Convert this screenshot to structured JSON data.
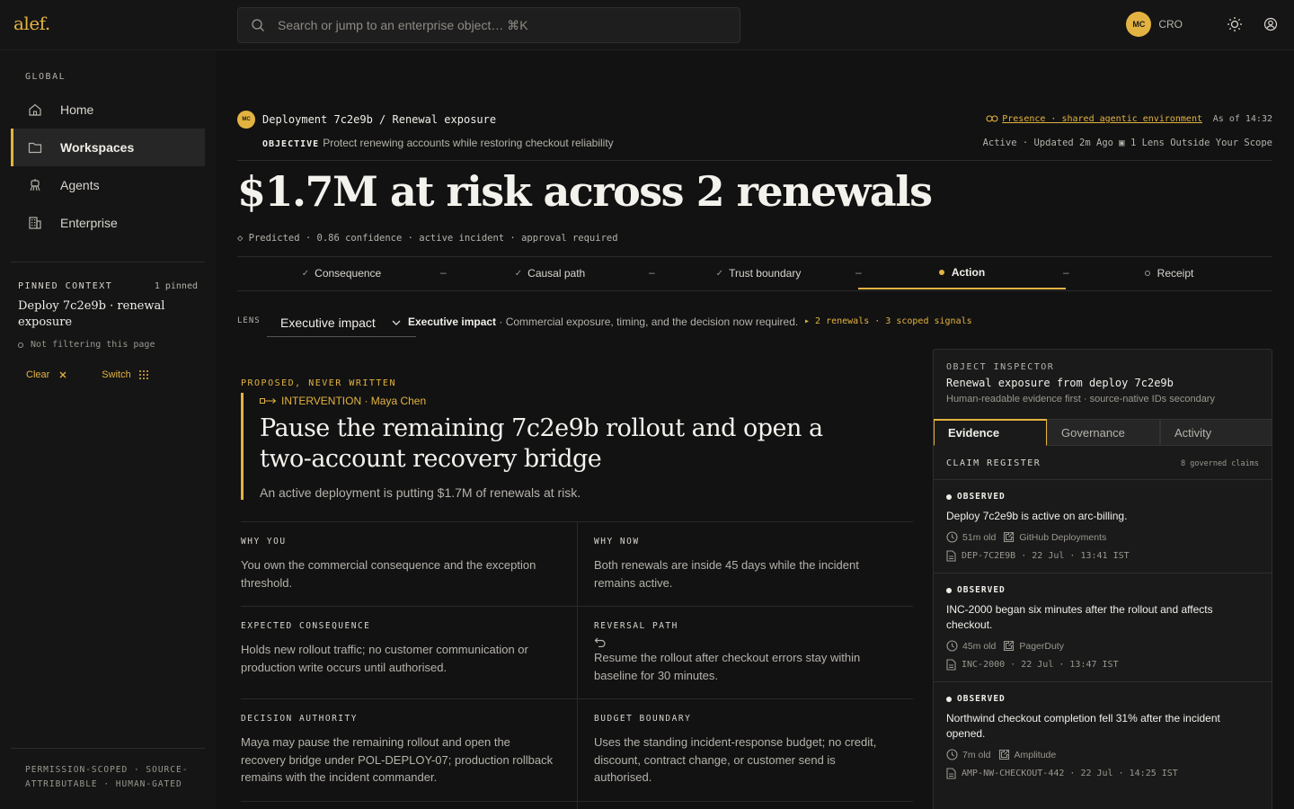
{
  "app": {
    "logo": "alef."
  },
  "search": {
    "placeholder": "Search or jump to an enterprise object… ⌘K"
  },
  "user": {
    "initials": "MC",
    "role": "CRO"
  },
  "sidebar": {
    "section_label": "GLOBAL",
    "items": [
      {
        "label": "Home",
        "icon": "home-icon"
      },
      {
        "label": "Workspaces",
        "icon": "folder-icon",
        "active": true
      },
      {
        "label": "Agents",
        "icon": "agent-icon"
      },
      {
        "label": "Enterprise",
        "icon": "building-icon"
      }
    ],
    "pinned": {
      "label": "PINNED CONTEXT",
      "count": "1 pinned",
      "title": "Deploy 7c2e9b · renewal exposure",
      "filter_note": "Not filtering this page",
      "clear": "Clear",
      "switch": "Switch"
    },
    "footer": "PERMISSION-SCOPED · SOURCE-ATTRIBUTABLE · HUMAN-GATED"
  },
  "header": {
    "avatar": "MC",
    "breadcrumb": "Deployment 7c2e9b / Renewal exposure",
    "presence": "Presence · shared agentic environment",
    "as_of": "As of 14:32",
    "objective_label": "OBJECTIVE",
    "objective": "Protect renewing accounts while restoring checkout reliability",
    "status": "Active · Updated 2m Ago  ▣  1 Lens Outside Your Scope",
    "headline": "$1.7M at risk across 2 renewals",
    "tags": "◇ Predicted · 0.86 confidence · active incident · approval required"
  },
  "steps": [
    {
      "label": "Consequence",
      "state": "done"
    },
    {
      "label": "Causal path",
      "state": "done"
    },
    {
      "label": "Trust boundary",
      "state": "done"
    },
    {
      "label": "Action",
      "state": "active"
    },
    {
      "label": "Receipt",
      "state": "pending"
    }
  ],
  "lens": {
    "label": "LENS",
    "selected": "Executive impact",
    "desc_title": "Executive impact",
    "desc": "· Commercial exposure, timing, and the decision now required.",
    "signals": "▸ 2 renewals · 3 scoped signals"
  },
  "proposal": {
    "label": "PROPOSED, NEVER WRITTEN",
    "intervention": "INTERVENTION · Maya Chen",
    "title": "Pause the remaining 7c2e9b rollout and open a two-account recovery bridge",
    "subtitle": "An active deployment is putting $1.7M of renewals at risk."
  },
  "grid": [
    {
      "h": "WHY YOU",
      "t": "You own the commercial consequence and the exception threshold."
    },
    {
      "h": "WHY NOW",
      "t": "Both renewals are inside 45 days while the incident remains active."
    },
    {
      "h": "EXPECTED CONSEQUENCE",
      "t": "Holds new rollout traffic; no customer communication or production write occurs until authorised."
    },
    {
      "h": "REVERSAL PATH",
      "t": "Resume the rollout after checkout errors stay within baseline for 30 minutes."
    },
    {
      "h": "DECISION AUTHORITY",
      "t": "Maya may pause the remaining rollout and open the recovery bridge under POL-DEPLOY-07; production rollback remains with the incident commander."
    },
    {
      "h": "BUDGET BOUNDARY",
      "t": "Uses the standing incident-response budget; no credit, discount, contract change, or customer send is authorised."
    }
  ],
  "inspector": {
    "label": "OBJECT INSPECTOR",
    "title": "Renewal exposure from deploy 7c2e9b",
    "subtitle": "Human-readable evidence first · source-native IDs secondary",
    "tabs": [
      "Evidence",
      "Governance",
      "Activity"
    ],
    "claims_label": "CLAIM REGISTER",
    "claims_count": "8 governed claims",
    "claims": [
      {
        "tag": "OBSERVED",
        "text": "Deploy 7c2e9b is active on arc-billing.",
        "age": "51m old",
        "source": "GitHub Deployments",
        "ref": "DEP-7C2E9B · 22 Jul · 13:41 IST"
      },
      {
        "tag": "OBSERVED",
        "text": "INC-2000 began six minutes after the rollout and affects checkout.",
        "age": "45m old",
        "source": "PagerDuty",
        "ref": "INC-2000 · 22 Jul · 13:47 IST"
      },
      {
        "tag": "OBSERVED",
        "text": "Northwind checkout completion fell 31% after the incident opened.",
        "age": "7m old",
        "source": "Amplitude",
        "ref": "AMP-NW-CHECKOUT-442 · 22 Jul · 14:25 IST"
      }
    ]
  },
  "colors": {
    "accent": "#e3b341",
    "bg": "#121212",
    "panel": "#1a1a1a"
  }
}
